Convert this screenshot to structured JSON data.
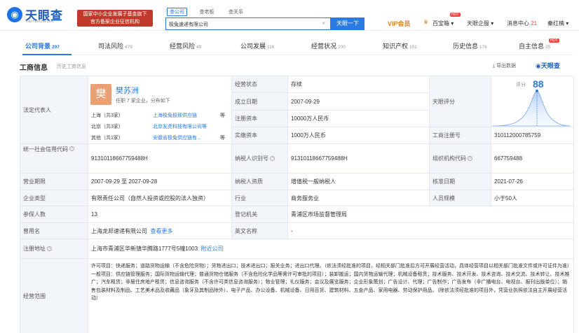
{
  "header": {
    "logo_text": "天眼查",
    "logo_sub": "TianYanCha.com",
    "banner_line1": "国家中小企业发展子基金旗下",
    "banner_line2": "官方备案企业征信机构",
    "search_tabs": [
      "查公司",
      "查老板",
      "查关系"
    ],
    "search_value": "极兔速递有限公司",
    "search_button": "天眼一下",
    "vip": "VIP会员",
    "nav": [
      "百宝箱",
      "天眼企服",
      "消息中心",
      "秦红楠"
    ],
    "hot_badge": "HOT",
    "message_count": "21"
  },
  "tabs": [
    {
      "label": "公司背景",
      "count": "297"
    },
    {
      "label": "司法风险",
      "count": "479"
    },
    {
      "label": "经营风险",
      "count": "49"
    },
    {
      "label": "公司发展",
      "count": "116"
    },
    {
      "label": "经营状况",
      "count": "200"
    },
    {
      "label": "知识产权",
      "count": "151"
    },
    {
      "label": "历史信息",
      "count": "176"
    },
    {
      "label": "自主信息",
      "count": "25"
    }
  ],
  "section": {
    "title": "工商信息",
    "history": "历史工商信息",
    "export": "导出数据",
    "brand": "天眼查"
  },
  "legal_rep": {
    "label": "法定代表人",
    "avatar_char": "樊",
    "name": "樊苏洲",
    "desc": "任职 7 家企业，分布如下",
    "rows": [
      {
        "region": "上海（共3家）",
        "company": "上海极兔极致供应链",
        "suffix": "等"
      },
      {
        "region": "北京（共3家）",
        "company": "北京友虎科技有限公司等",
        "suffix": ""
      },
      {
        "region": "其他（共1家）",
        "company": "安徽省极兔供应链有...",
        "suffix": "等"
      }
    ]
  },
  "fields": {
    "status_label": "经营状态",
    "status": "存续",
    "founded_label": "成立日期",
    "founded": "2007-09-29",
    "capital_label": "注册资本",
    "capital": "10000万人民币",
    "paid_label": "实缴资本",
    "paid": "1000万人民币",
    "score_label": "天眼评分",
    "score_title": "评分",
    "score_value": "88",
    "reg_no_label": "工商注册号",
    "reg_no": "310112000785759",
    "credit_code_label": "统一社会信用代码",
    "credit_code": "91310118667759488H",
    "taxpayer_id_label": "纳税人识别号",
    "taxpayer_id": "91310118667759488H",
    "org_code_label": "组织机构代码",
    "org_code": "667759488",
    "term_label": "营业期限",
    "term": "2007-09-29 至 2027-09-28",
    "taxpayer_q_label": "纳税人资质",
    "taxpayer_q": "增值税一般纳税人",
    "approve_label": "核准日期",
    "approve": "2021-07-26",
    "type_label": "企业类型",
    "type": "有限责任公司（自然人投资或控股的法人独资）",
    "industry_label": "行业",
    "industry": "商务服务业",
    "scale_label": "人员规模",
    "scale": "小于50人",
    "insured_label": "参保人数",
    "insured": "13",
    "authority_label": "登记机关",
    "authority": "青浦区市场监督管理局",
    "former_label": "曾用名",
    "former": "上海龙邦速递有限公司",
    "former_more": "查看更多",
    "en_label": "英文名称",
    "en": "-",
    "addr_label": "注册地址",
    "addr": "上海市青浦区华新镇华腾路1777号5幢1003",
    "addr_link": "附近公司",
    "scope_label": "经营范围",
    "scope": "许可项目：快递服务；道路货物运输（不含危险货物）；货物进出口；技术进出口；报关业务；进出口代理。（依法须经批准的项目，经相关部门批准后方可开展经营活动，具体经营项目以相关部门批准文件或许可证件为准）一般项目：供应链管理服务；国际货物运输代理；普通货物仓储服务（不含危险化学品等需许可审批的项目）；装卸搬运；国内货物运输代理；机械设备租赁；技术服务、技术开发、技术咨询、技术交流、技术转让、技术推广；汽车租赁；非居住房地产租赁；信息咨询服务（不含许可类信息咨询服务）；物业管理；礼仪服务；会议及展览服务；企业形象策划；广告设计、代理；广告制作；广告发布（非广播电台、电视台、报刊出版单位）；销售包装材料及制品、工艺美术品及收藏品（象牙及其制品除外）、电子产品、办公设备、机械设备、日用百货、建筑材料、五金产品、家用电器、劳动保护用品。（除依法须经批准的项目外，凭营业执照依法自主开展经营活动）"
  }
}
